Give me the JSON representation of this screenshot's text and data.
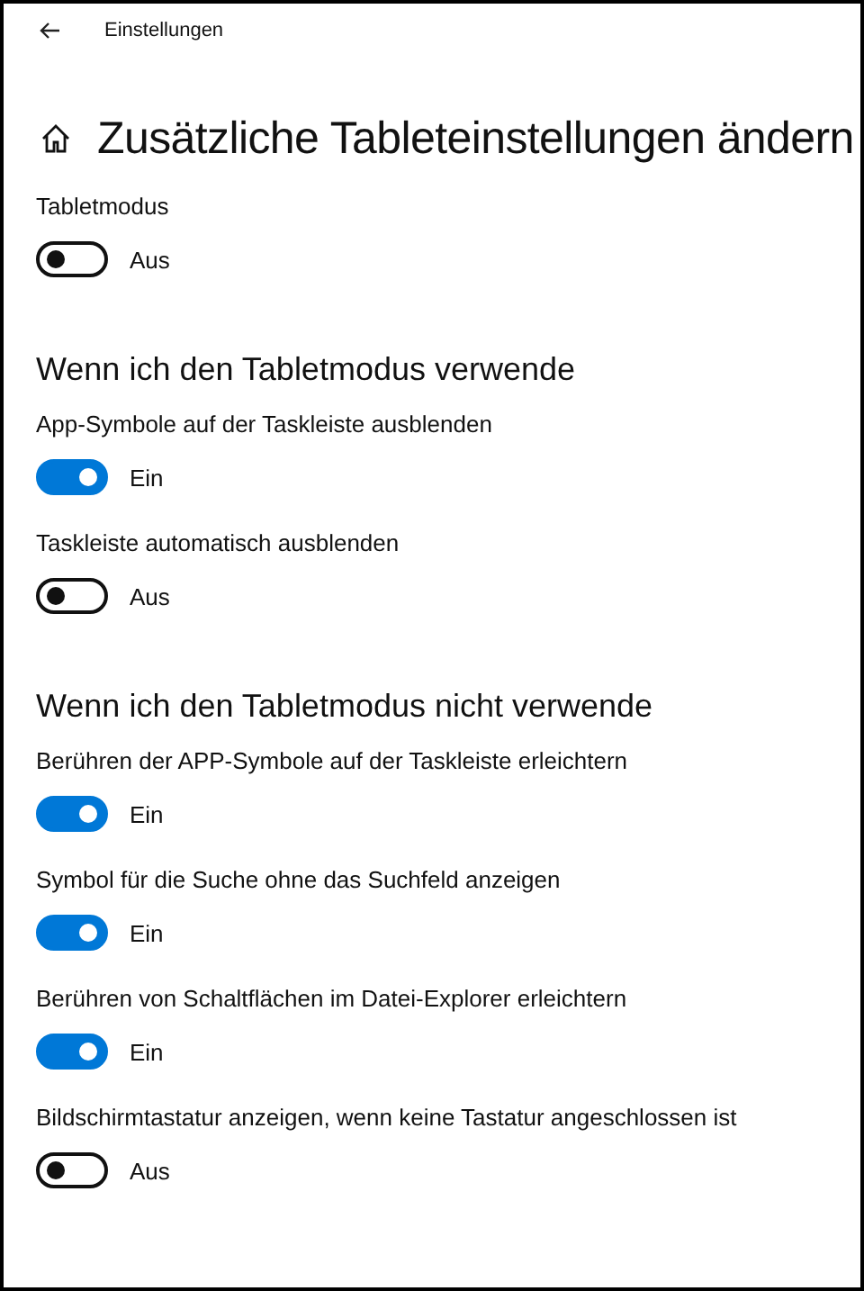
{
  "window": {
    "title": "Einstellungen"
  },
  "page_title": "Zusätzliche Tableteinstellungen ändern",
  "items": [
    {
      "kind": "toggle",
      "label": "Tabletmodus",
      "on": false,
      "state_text": "Aus"
    },
    {
      "kind": "heading",
      "label": "Wenn ich den Tabletmodus verwende"
    },
    {
      "kind": "toggle",
      "label": "App-Symbole auf der Taskleiste ausblenden",
      "on": true,
      "state_text": "Ein"
    },
    {
      "kind": "toggle",
      "label": "Taskleiste automatisch ausblenden",
      "on": false,
      "state_text": "Aus"
    },
    {
      "kind": "heading",
      "label": "Wenn ich den Tabletmodus nicht verwende"
    },
    {
      "kind": "toggle",
      "label": "Berühren der APP-Symbole auf der Taskleiste erleichtern",
      "on": true,
      "state_text": "Ein"
    },
    {
      "kind": "toggle",
      "label": "Symbol für die Suche ohne das Suchfeld anzeigen",
      "on": true,
      "state_text": "Ein"
    },
    {
      "kind": "toggle",
      "label": "Berühren von Schaltflächen im Datei-Explorer erleichtern",
      "on": true,
      "state_text": "Ein"
    },
    {
      "kind": "toggle",
      "label": "Bildschirmtastatur anzeigen, wenn keine Tastatur angeschlossen ist",
      "on": false,
      "state_text": "Aus"
    }
  ]
}
